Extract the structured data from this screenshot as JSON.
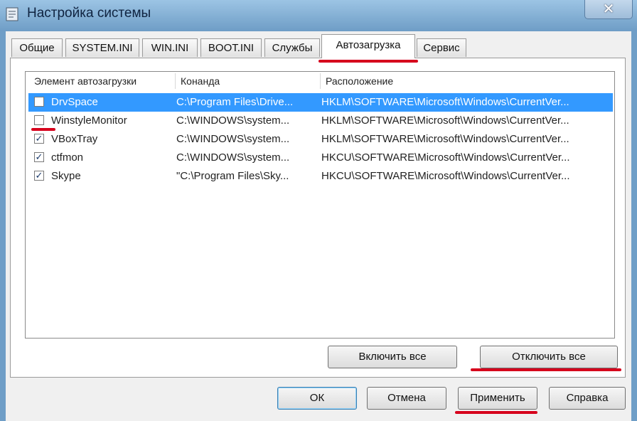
{
  "window": {
    "title": "Настройка системы",
    "close_glyph": "✕"
  },
  "tabs": [
    {
      "label": "Общие"
    },
    {
      "label": "SYSTEM.INI"
    },
    {
      "label": "WIN.INI"
    },
    {
      "label": "BOOT.INI"
    },
    {
      "label": "Службы"
    },
    {
      "label": "Автозагрузка",
      "active": true
    },
    {
      "label": "Сервис"
    }
  ],
  "startup_list": {
    "columns": [
      "Элемент автозагрузки",
      "Конанда",
      "Расположение"
    ],
    "rows": [
      {
        "name": "DrvSpace",
        "command": "C:\\Program Files\\Drive...",
        "location": "HKLM\\SOFTWARE\\Microsoft\\Windows\\CurrentVer...",
        "checked": false,
        "selected": true,
        "check_glyph": ""
      },
      {
        "name": "WinstyleMonitor",
        "command": "C:\\WINDOWS\\system...",
        "location": "HKLM\\SOFTWARE\\Microsoft\\Windows\\CurrentVer...",
        "checked": false,
        "selected": false,
        "check_glyph": ""
      },
      {
        "name": "VBoxTray",
        "command": "C:\\WINDOWS\\system...",
        "location": "HKLM\\SOFTWARE\\Microsoft\\Windows\\CurrentVer...",
        "checked": true,
        "selected": false,
        "check_glyph": "✓"
      },
      {
        "name": "ctfmon",
        "command": "C:\\WINDOWS\\system...",
        "location": "HKCU\\SOFTWARE\\Microsoft\\Windows\\CurrentVer...",
        "checked": true,
        "selected": false,
        "check_glyph": "✓"
      },
      {
        "name": "Skype",
        "command": "\"C:\\Program Files\\Sky...",
        "location": "HKCU\\SOFTWARE\\Microsoft\\Windows\\CurrentVer...",
        "checked": true,
        "selected": false,
        "check_glyph": "✓"
      }
    ]
  },
  "panel_buttons": {
    "enable_all": "Включить все",
    "disable_all": "Отключить все"
  },
  "dialog_buttons": {
    "ok": "ОК",
    "cancel": "Отмена",
    "apply": "Применить",
    "help": "Справка"
  },
  "colors": {
    "selection": "#3399ff",
    "annotation": "#d6001c",
    "title_bar": "#7aa7cf"
  },
  "icons": {
    "app": "settings-window-icon",
    "close": "close-icon",
    "check": "checkmark-icon"
  }
}
